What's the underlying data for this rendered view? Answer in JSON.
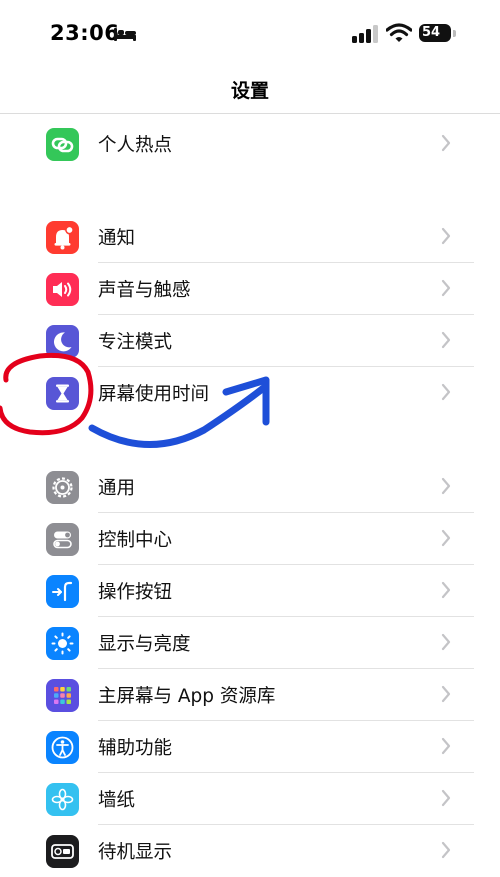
{
  "status_bar": {
    "time": "23:06",
    "battery": "54"
  },
  "header": {
    "title": "设置"
  },
  "groups": [
    {
      "items": [
        {
          "label": "个人热点",
          "icon": "hotspot-icon",
          "color": "#34c759"
        }
      ]
    },
    {
      "items": [
        {
          "label": "通知",
          "icon": "notifications-icon",
          "color": "#ff3b30"
        },
        {
          "label": "声音与触感",
          "icon": "sound-icon",
          "color": "#ff2d55"
        },
        {
          "label": "专注模式",
          "icon": "focus-moon-icon",
          "color": "#5856d6"
        },
        {
          "label": "屏幕使用时间",
          "icon": "hourglass-icon",
          "color": "#5856d6"
        }
      ]
    },
    {
      "items": [
        {
          "label": "通用",
          "icon": "gear-icon",
          "color": "#8e8e93"
        },
        {
          "label": "控制中心",
          "icon": "toggles-icon",
          "color": "#8e8e93"
        },
        {
          "label": "操作按钮",
          "icon": "action-button-icon",
          "color": "#0a84ff"
        },
        {
          "label": "显示与亮度",
          "icon": "brightness-icon",
          "color": "#0a84ff"
        },
        {
          "label": "主屏幕与 App 资源库",
          "icon": "home-screen-grid-icon",
          "color": "#5a4fe0"
        },
        {
          "label": "辅助功能",
          "icon": "accessibility-icon",
          "color": "#0a84ff"
        },
        {
          "label": "墙纸",
          "icon": "wallpaper-flower-icon",
          "color": "#34c1f0"
        },
        {
          "label": "待机显示",
          "icon": "standby-icon",
          "color": "#1c1c1e"
        }
      ]
    }
  ],
  "annotation": {
    "circle_color": "#e4001b",
    "arrow_color": "#1e4fd8"
  }
}
